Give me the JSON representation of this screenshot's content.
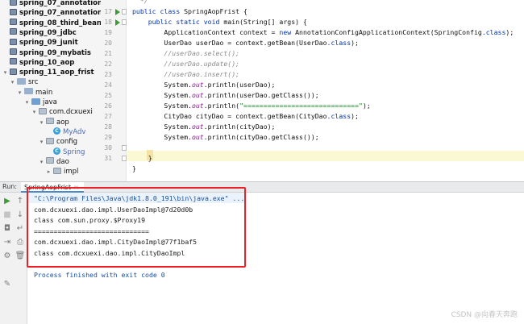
{
  "project_tree": {
    "items": [
      {
        "label": "spring_07_annotation",
        "icon": "module-icon",
        "depth": 0,
        "bold": true
      },
      {
        "label": "spring_07_annotation_be",
        "icon": "module-icon",
        "depth": 0,
        "bold": true
      },
      {
        "label": "spring_08_third_bean",
        "icon": "module-icon",
        "depth": 0,
        "bold": true
      },
      {
        "label": "spring_09_jdbc",
        "icon": "module-icon",
        "depth": 0,
        "bold": true
      },
      {
        "label": "spring_09_junit",
        "icon": "module-icon",
        "depth": 0,
        "bold": true
      },
      {
        "label": "spring_09_mybatis",
        "icon": "module-icon",
        "depth": 0,
        "bold": true
      },
      {
        "label": "spring_10_aop",
        "icon": "module-icon",
        "depth": 0,
        "bold": true
      },
      {
        "label": "spring_11_aop_frist",
        "icon": "module-icon",
        "depth": 0,
        "bold": true,
        "expanded": true
      },
      {
        "label": "src",
        "icon": "folder-icon",
        "depth": 1,
        "expanded": true
      },
      {
        "label": "main",
        "icon": "folder-icon",
        "depth": 2,
        "expanded": true
      },
      {
        "label": "java",
        "icon": "source-folder-icon",
        "depth": 3,
        "expanded": true
      },
      {
        "label": "com.dcxuexi",
        "icon": "package-icon",
        "depth": 4,
        "expanded": true
      },
      {
        "label": "aop",
        "icon": "package-icon",
        "depth": 5,
        "expanded": true
      },
      {
        "label": "MyAdv",
        "icon": "class-icon",
        "depth": 6,
        "kind": "class"
      },
      {
        "label": "config",
        "icon": "package-icon",
        "depth": 5,
        "expanded": true
      },
      {
        "label": "Spring",
        "icon": "class-icon",
        "depth": 6,
        "kind": "class"
      },
      {
        "label": "dao",
        "icon": "package-icon",
        "depth": 5,
        "expanded": true
      },
      {
        "label": "impl",
        "icon": "package-icon",
        "depth": 6,
        "expanded": false
      }
    ]
  },
  "editor": {
    "line_numbers": [
      "17",
      "18",
      "19",
      "20",
      "21",
      "22",
      "23",
      "24",
      "25",
      "26",
      "27",
      "28",
      "29",
      "30",
      "31"
    ],
    "lines": [
      "  */",
      "public class SpringAopFrist {",
      "    public static void main(String[] args) {",
      "        ApplicationContext context = new AnnotationConfigApplicationContext(SpringConfig.class);",
      "        UserDao userDao = context.getBean(UserDao.class);",
      "        //userDao.select();",
      "        //userDao.update();",
      "        //userDao.insert();",
      "        System.out.println(userDao);",
      "        System.out.println(userDao.getClass());",
      "        System.out.println(\"=============================\");",
      "        CityDao cityDao = context.getBean(CityDao.class);",
      "        System.out.println(cityDao);",
      "        System.out.println(cityDao.getClass());",
      "",
      "    }",
      "}"
    ]
  },
  "run_panel": {
    "label": "Run:",
    "tab_label": "SpringAopFrist",
    "tab_close": "×",
    "output": [
      "\"C:\\Program Files\\Java\\jdk1.8.0_191\\bin\\java.exe\" ...",
      "com.dcxuexi.dao.impl.UserDaoImpl@7d20d0b",
      "class com.sun.proxy.$Proxy19",
      "=============================",
      "com.dcxuexi.dao.impl.CityDaoImpl@77f1baf5",
      "class com.dcxuexi.dao.impl.CityDaoImpl",
      "",
      "Process finished with exit code 0"
    ],
    "toolbar_icons": [
      "rerun-icon",
      "scroll-up-icon",
      "stop-icon",
      "scroll-down-icon",
      "camera-icon",
      "wrap-icon",
      "exit-icon",
      "print-icon",
      "settings-icon",
      "delete-icon",
      "pin-icon"
    ]
  },
  "watermark": "CSDN @向春天奔跑",
  "colors": {
    "keyword": "#0033b3",
    "static_field": "#871094",
    "comment": "#8c8c8c",
    "string": "#067d17",
    "annotation_box": "#ec2027"
  }
}
